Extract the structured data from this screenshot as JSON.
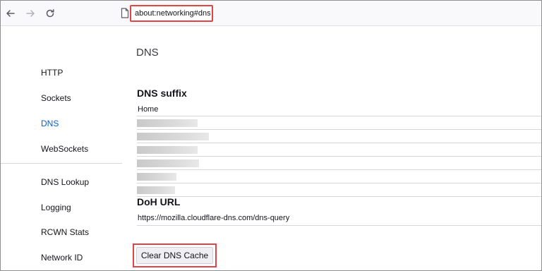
{
  "toolbar": {
    "back_icon": "arrow-left-icon",
    "forward_icon": "arrow-right-icon",
    "reload_icon": "reload-icon",
    "page_icon": "page-icon",
    "url": "about:networking#dns"
  },
  "sidebar": {
    "items": [
      {
        "label": "HTTP",
        "active": false
      },
      {
        "label": "Sockets",
        "active": false
      },
      {
        "label": "DNS",
        "active": true
      },
      {
        "label": "WebSockets",
        "active": false
      },
      {
        "label": "DNS Lookup",
        "active": false
      },
      {
        "label": "Logging",
        "active": false
      },
      {
        "label": "RCWN Stats",
        "active": false
      },
      {
        "label": "Network ID",
        "active": false
      }
    ]
  },
  "main": {
    "title": "DNS",
    "dns_suffix": {
      "heading": "DNS suffix",
      "rows": [
        {
          "text": "Home",
          "redacted": false
        },
        {
          "text": "",
          "redacted": true
        },
        {
          "text": "",
          "redacted": true
        },
        {
          "text": "",
          "redacted": true
        },
        {
          "text": "",
          "redacted": true
        },
        {
          "text": "",
          "redacted": true
        },
        {
          "text": "",
          "redacted": true
        }
      ]
    },
    "doh": {
      "heading": "DoH URL",
      "url": "https://mozilla.cloudflare-dns.com/dns-query"
    },
    "clear_button_label": "Clear DNS Cache"
  },
  "colors": {
    "highlight_border": "#e04545",
    "active_link": "#0061e0"
  }
}
